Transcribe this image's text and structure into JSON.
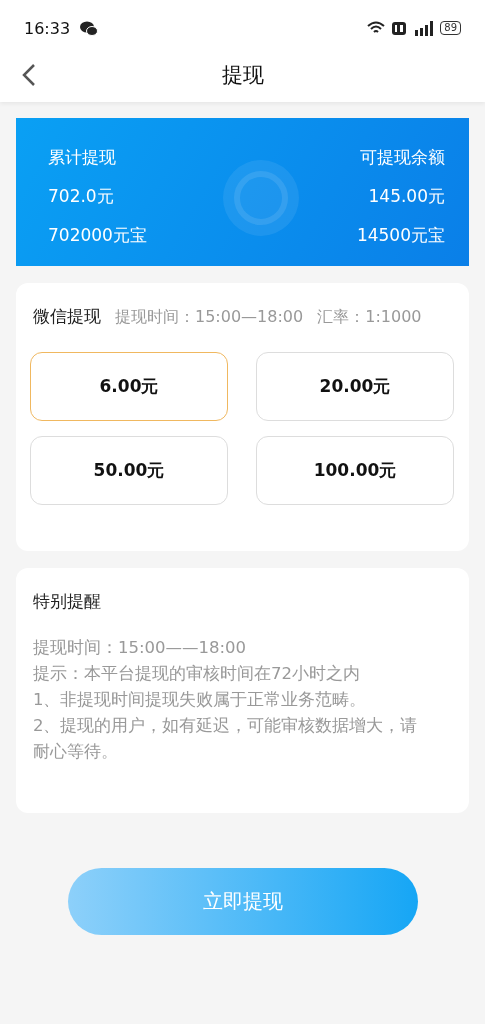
{
  "status_bar": {
    "time": "16:33",
    "battery": "89"
  },
  "header": {
    "title": "提现"
  },
  "summary": {
    "left": {
      "label": "累计提现",
      "amount": "702.0元",
      "coins": "702000元宝"
    },
    "right": {
      "label": "可提现余额",
      "amount": "145.00元",
      "coins": "14500元宝"
    }
  },
  "withdraw": {
    "title": "微信提现",
    "time": "提现时间：15:00—18:00",
    "rate": "汇率：1:1000",
    "options": [
      {
        "label": "6.00元",
        "selected": true
      },
      {
        "label": "20.00元",
        "selected": false
      },
      {
        "label": "50.00元",
        "selected": false
      },
      {
        "label": "100.00元",
        "selected": false
      }
    ]
  },
  "notice": {
    "title": "特别提醒",
    "lines": [
      "提现时间：15:00——18:00",
      "提示：本平台提现的审核时间在72小时之内",
      "1、非提现时间提现失败属于正常业务范畴。",
      "2、提现的用户，如有延迟，可能审核数据增大，请耐心等待。"
    ]
  },
  "submit_button": "立即提现"
}
